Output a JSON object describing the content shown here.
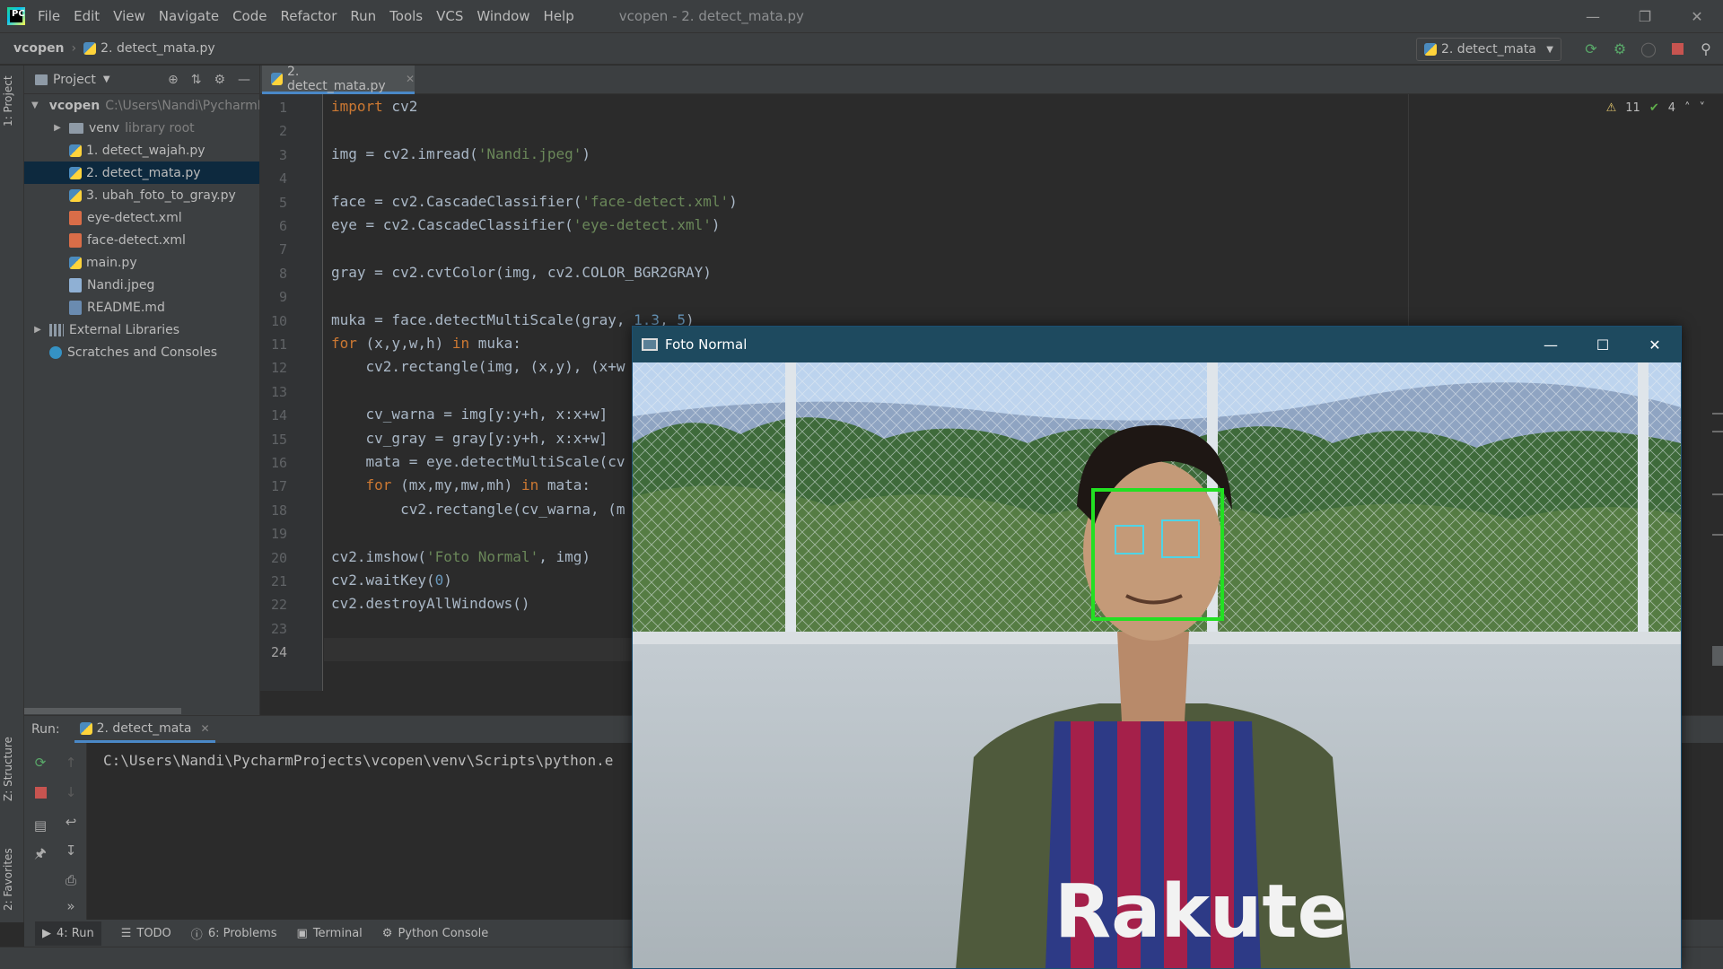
{
  "app": {
    "logo_text": "PC",
    "menu": [
      "File",
      "Edit",
      "View",
      "Navigate",
      "Code",
      "Refactor",
      "Run",
      "Tools",
      "VCS",
      "Window",
      "Help"
    ],
    "window_title": "vcopen - 2. detect_mata.py"
  },
  "breadcrumb": {
    "root": "vcopen",
    "file": "2. detect_mata.py"
  },
  "run_config": {
    "label": "2. detect_mata"
  },
  "project_panel": {
    "title": "Project",
    "tree": [
      {
        "name": "vcopen",
        "hint": "C:\\Users\\Nandi\\PycharmProjects\\vcopen",
        "level": 0,
        "kind": "folder",
        "open": true
      },
      {
        "name": "venv",
        "hint": "library root",
        "level": 1,
        "kind": "folder",
        "open": false
      },
      {
        "name": "1. detect_wajah.py",
        "level": 1,
        "kind": "py"
      },
      {
        "name": "2. detect_mata.py",
        "level": 1,
        "kind": "py",
        "selected": true
      },
      {
        "name": "3. ubah_foto_to_gray.py",
        "level": 1,
        "kind": "py"
      },
      {
        "name": "eye-detect.xml",
        "level": 1,
        "kind": "xml"
      },
      {
        "name": "face-detect.xml",
        "level": 1,
        "kind": "xml"
      },
      {
        "name": "main.py",
        "level": 1,
        "kind": "py"
      },
      {
        "name": "Nandi.jpeg",
        "level": 1,
        "kind": "img"
      },
      {
        "name": "README.md",
        "level": 1,
        "kind": "md"
      },
      {
        "name": "External Libraries",
        "level": 0,
        "kind": "lib",
        "open": false
      },
      {
        "name": "Scratches and Consoles",
        "level": 0,
        "kind": "scratch"
      }
    ]
  },
  "stripe": {
    "project": "1: Project",
    "structure": "Z: Structure",
    "favorites": "2: Favorites"
  },
  "editor": {
    "tab": "2. detect_mata.py",
    "inspections": {
      "warnings": "11",
      "ok": "4"
    },
    "lines": [
      "import cv2",
      "",
      "img = cv2.imread('Nandi.jpeg')",
      "",
      "face = cv2.CascadeClassifier('face-detect.xml')",
      "eye = cv2.CascadeClassifier('eye-detect.xml')",
      "",
      "gray = cv2.cvtColor(img, cv2.COLOR_BGR2GRAY)",
      "",
      "muka = face.detectMultiScale(gray, 1.3, 5)",
      "for (x,y,w,h) in muka:",
      "    cv2.rectangle(img, (x,y), (x+w",
      "",
      "    cv_warna = img[y:y+h, x:x+w]",
      "    cv_gray = gray[y:y+h, x:x+w]",
      "    mata = eye.detectMultiScale(cv",
      "    for (mx,my,mw,mh) in mata:",
      "        cv2.rectangle(cv_warna, (m",
      "",
      "cv2.imshow('Foto Normal', img)",
      "cv2.waitKey(0)",
      "cv2.destroyAllWindows()",
      "",
      ""
    ],
    "current_line": "24"
  },
  "run_panel": {
    "label": "Run:",
    "tab": "2. detect_mata",
    "console": "C:\\Users\\Nandi\\PycharmProjects\\vcopen\\venv\\Scripts\\python.e"
  },
  "tool_tabs": [
    {
      "label": "4: Run",
      "icon": "run-icon",
      "active": true
    },
    {
      "label": "TODO",
      "icon": "todo-icon"
    },
    {
      "label": "6: Problems",
      "icon": "problems-icon"
    },
    {
      "label": "Terminal",
      "icon": "terminal-icon"
    },
    {
      "label": "Python Console",
      "icon": "python-console-icon"
    }
  ],
  "photo_window": {
    "title": "Foto Normal",
    "jersey_text": "Rakute",
    "colors": {
      "face_box": "#22e022",
      "eye_box": "#4fd4e6",
      "titlebar": "#1e4a5f"
    }
  }
}
